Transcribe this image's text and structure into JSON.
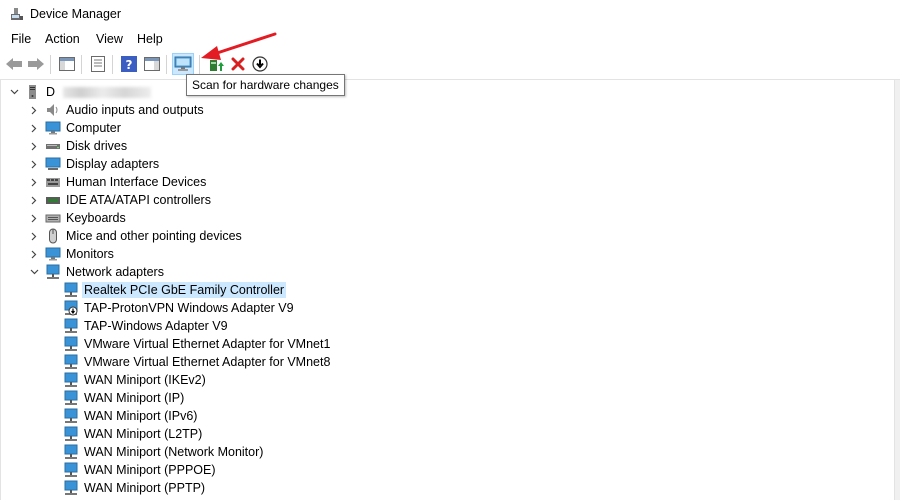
{
  "window": {
    "title": "Device Manager"
  },
  "menu": [
    "File",
    "Action",
    "View",
    "Help"
  ],
  "toolbar": {
    "tooltip": "Scan for hardware changes"
  },
  "tree": {
    "root": {
      "label": "D"
    },
    "categories": [
      "Audio inputs and outputs",
      "Computer",
      "Disk drives",
      "Display adapters",
      "Human Interface Devices",
      "IDE ATA/ATAPI controllers",
      "Keyboards",
      "Mice and other pointing devices",
      "Monitors",
      "Network adapters"
    ],
    "network_adapters": [
      "Realtek PCIe GbE Family Controller",
      "TAP-ProtonVPN Windows Adapter V9",
      "TAP-Windows Adapter V9",
      "VMware Virtual Ethernet Adapter for VMnet1",
      "VMware Virtual Ethernet Adapter for VMnet8",
      "WAN Miniport (IKEv2)",
      "WAN Miniport (IP)",
      "WAN Miniport (IPv6)",
      "WAN Miniport (L2TP)",
      "WAN Miniport (Network Monitor)",
      "WAN Miniport (PPPOE)",
      "WAN Miniport (PPTP)"
    ],
    "selected_adapter": "Realtek PCIe GbE Family Controller"
  },
  "colors": {
    "selection": "#cce8ff",
    "annotation_arrow": "#e31b23"
  }
}
